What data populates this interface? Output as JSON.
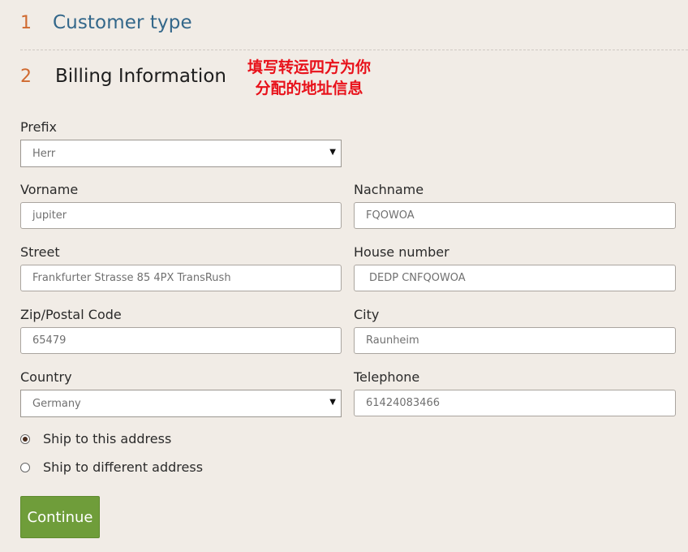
{
  "steps": [
    {
      "number": "1",
      "title": "Customer type"
    },
    {
      "number": "2",
      "title": "Billing Information"
    }
  ],
  "annotation": {
    "line1": "填写转运四方为你",
    "line2": "分配的地址信息"
  },
  "form": {
    "prefix": {
      "label": "Prefix",
      "value": "Herr"
    },
    "vorname": {
      "label": "Vorname",
      "value": "jupiter"
    },
    "nachname": {
      "label": "Nachname",
      "value": "FQOWOA"
    },
    "street": {
      "label": "Street",
      "value": "Frankfurter Strasse 85 4PX TransRush"
    },
    "house_number": {
      "label": "House number",
      "value": "DEDP CNFQOWOA"
    },
    "zip": {
      "label": "Zip/Postal Code",
      "value": "65479"
    },
    "city": {
      "label": "City",
      "value": "Raunheim"
    },
    "country": {
      "label": "Country",
      "value": "Germany"
    },
    "telephone": {
      "label": "Telephone",
      "value": "61424083466"
    }
  },
  "shipping": {
    "options": [
      {
        "label": "Ship to this address",
        "selected": true
      },
      {
        "label": "Ship to different address",
        "selected": false
      }
    ]
  },
  "actions": {
    "continue_label": "Continue"
  },
  "icons": {
    "select_arrow": "▼"
  },
  "colors": {
    "background": "#f1ece6",
    "step_number": "#d06a30",
    "step_link": "#33678a",
    "annotation": "#e8111a",
    "button": "#6f9d3a"
  }
}
